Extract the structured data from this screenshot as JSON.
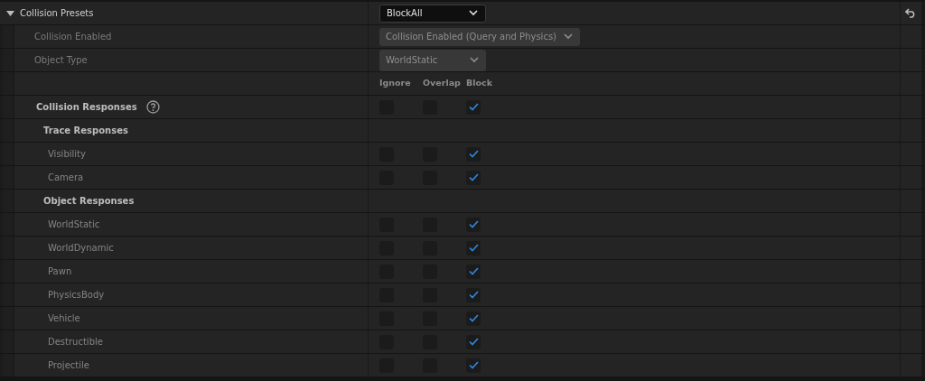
{
  "preset": {
    "label": "Collision Presets",
    "expanded": true,
    "value": "BlockAll"
  },
  "properties": [
    {
      "label": "Collision Enabled",
      "value": "Collision Enabled (Query and Physics)",
      "disabled": true
    },
    {
      "label": "Object Type",
      "value": "WorldStatic",
      "disabled": true
    }
  ],
  "response_columns": [
    "Ignore",
    "Overlap",
    "Block"
  ],
  "responses": [
    {
      "kind": "master",
      "label": "Collision Responses",
      "ignore": false,
      "overlap": false,
      "block": true
    },
    {
      "kind": "group",
      "label": "Trace Responses"
    },
    {
      "kind": "channel",
      "label": "Visibility",
      "ignore": false,
      "overlap": false,
      "block": true
    },
    {
      "kind": "channel",
      "label": "Camera",
      "ignore": false,
      "overlap": false,
      "block": true
    },
    {
      "kind": "group",
      "label": "Object Responses"
    },
    {
      "kind": "channel",
      "label": "WorldStatic",
      "ignore": false,
      "overlap": false,
      "block": true
    },
    {
      "kind": "channel",
      "label": "WorldDynamic",
      "ignore": false,
      "overlap": false,
      "block": true
    },
    {
      "kind": "channel",
      "label": "Pawn",
      "ignore": false,
      "overlap": false,
      "block": true
    },
    {
      "kind": "channel",
      "label": "PhysicsBody",
      "ignore": false,
      "overlap": false,
      "block": true
    },
    {
      "kind": "channel",
      "label": "Vehicle",
      "ignore": false,
      "overlap": false,
      "block": true
    },
    {
      "kind": "channel",
      "label": "Destructible",
      "ignore": false,
      "overlap": false,
      "block": true
    },
    {
      "kind": "channel",
      "label": "Projectile",
      "ignore": false,
      "overlap": false,
      "block": true
    }
  ]
}
